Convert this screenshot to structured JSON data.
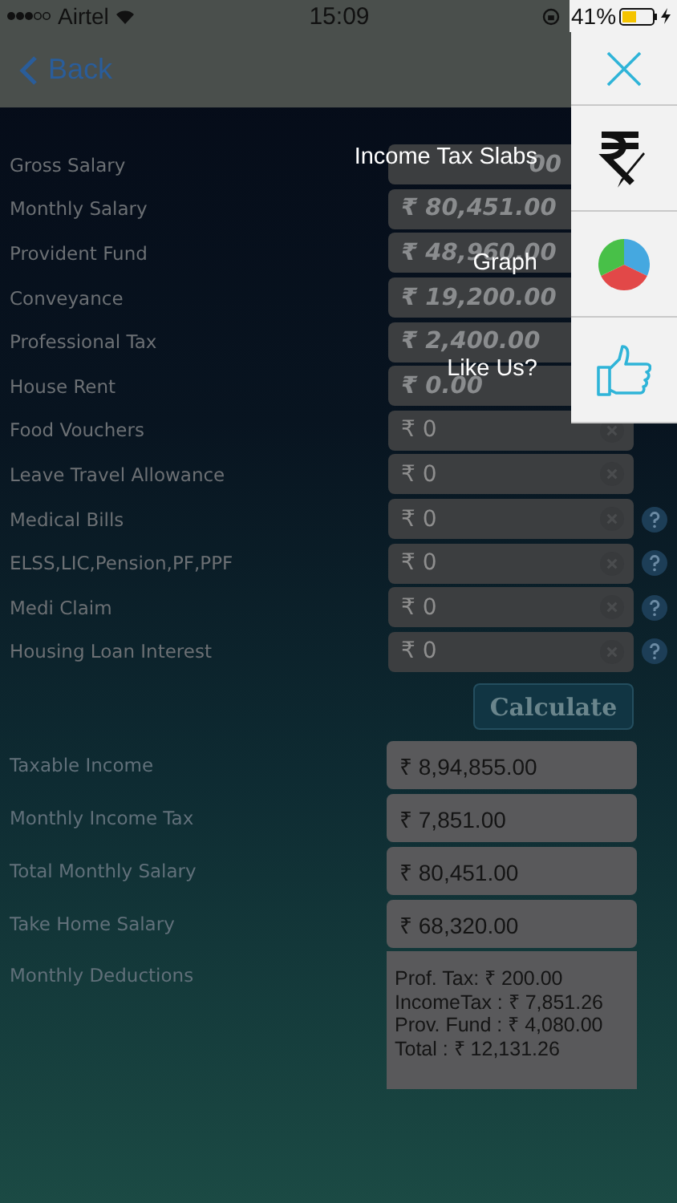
{
  "status_bar": {
    "carrier": "Airtel",
    "time": "15:09",
    "battery": "41%"
  },
  "nav": {
    "back": "Back"
  },
  "side_menu": {
    "items": [
      {
        "label": "Income Tax Slabs",
        "kind": "rupee"
      },
      {
        "label": "Graph",
        "kind": "graph"
      },
      {
        "label": "Like Us?",
        "kind": "like"
      }
    ]
  },
  "inputs": [
    {
      "label": "Gross Salary",
      "value": "00",
      "emphasized": true,
      "covered": true,
      "clear_button": false,
      "help": false
    },
    {
      "label": "Monthly Salary",
      "value": "₹ 80,451.00",
      "emphasized": true,
      "covered": false,
      "clear_button": false,
      "help": false
    },
    {
      "label": "Provident Fund",
      "value": "₹ 48,960.00",
      "emphasized": true,
      "covered": false,
      "clear_button": false,
      "help": false
    },
    {
      "label": "Conveyance",
      "value": "₹ 19,200.00",
      "emphasized": true,
      "covered": false,
      "clear_button": false,
      "help": false
    },
    {
      "label": "Professional Tax",
      "value": "₹ 2,400.00",
      "emphasized": true,
      "covered": false,
      "clear_button": false,
      "help": false
    },
    {
      "label": "House Rent",
      "value": "₹ 0.00",
      "emphasized": true,
      "covered": false,
      "clear_button": false,
      "help": false
    },
    {
      "label": "Food Vouchers",
      "value": "₹ 0",
      "emphasized": false,
      "covered": false,
      "clear_button": true,
      "help": false
    },
    {
      "label": "Leave Travel Allowance",
      "value": "₹ 0",
      "emphasized": false,
      "covered": false,
      "clear_button": true,
      "help": false
    },
    {
      "label": "Medical Bills",
      "value": "₹ 0",
      "emphasized": false,
      "covered": false,
      "clear_button": true,
      "help": true
    },
    {
      "label": "ELSS,LIC,Pension,PF,PPF",
      "value": "₹ 0",
      "emphasized": false,
      "covered": false,
      "clear_button": true,
      "help": true
    },
    {
      "label": "Medi Claim",
      "value": "₹ 0",
      "emphasized": false,
      "covered": false,
      "clear_button": true,
      "help": true
    },
    {
      "label": "Housing Loan Interest",
      "value": "₹ 0",
      "emphasized": false,
      "covered": false,
      "clear_button": true,
      "help": true
    }
  ],
  "calculate": "Calculate",
  "results": [
    {
      "label": "Taxable Income",
      "value": "₹ 8,94,855.00"
    },
    {
      "label": "Monthly Income Tax",
      "value": "₹ 7,851.00"
    },
    {
      "label": "Total Monthly Salary",
      "value": "₹ 80,451.00"
    },
    {
      "label": "Take Home Salary",
      "value": "₹ 68,320.00"
    }
  ],
  "deductions": {
    "label": "Monthly Deductions",
    "lines": [
      "Prof. Tax: ₹ 200.00",
      "IncomeTax : ₹ 7,851.26",
      "Prov. Fund : ₹ 4,080.00",
      "Total : ₹ 12,131.26"
    ]
  }
}
